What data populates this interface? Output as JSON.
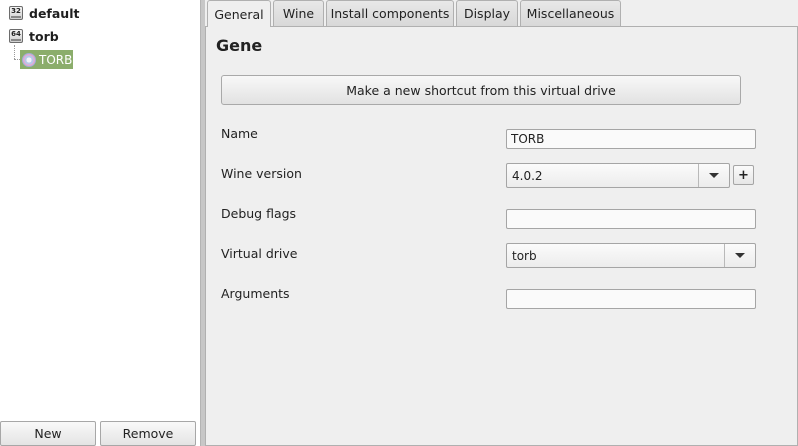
{
  "tree": {
    "items": [
      {
        "badge": "32",
        "label": "default"
      },
      {
        "badge": "64",
        "label": "torb"
      }
    ],
    "selected": {
      "label": "TORB",
      "icon": "app-icon"
    }
  },
  "bottom_buttons": {
    "new_label": "New",
    "remove_label": "Remove"
  },
  "tabs": [
    {
      "label": "General",
      "active": true
    },
    {
      "label": "Wine",
      "active": false
    },
    {
      "label": "Install components",
      "active": false
    },
    {
      "label": "Display",
      "active": false
    },
    {
      "label": "Miscellaneous",
      "active": false
    }
  ],
  "general": {
    "section_title": "Gene",
    "shortcut_button_label": "Make a new shortcut from this virtual drive",
    "fields": {
      "name": {
        "label": "Name",
        "value": "TORB"
      },
      "wine_version": {
        "label": "Wine version",
        "value": "4.0.2",
        "add_label": "+"
      },
      "debug_flags": {
        "label": "Debug flags",
        "value": ""
      },
      "virtual_drive": {
        "label": "Virtual drive",
        "value": "torb"
      },
      "arguments": {
        "label": "Arguments",
        "value": ""
      }
    }
  }
}
